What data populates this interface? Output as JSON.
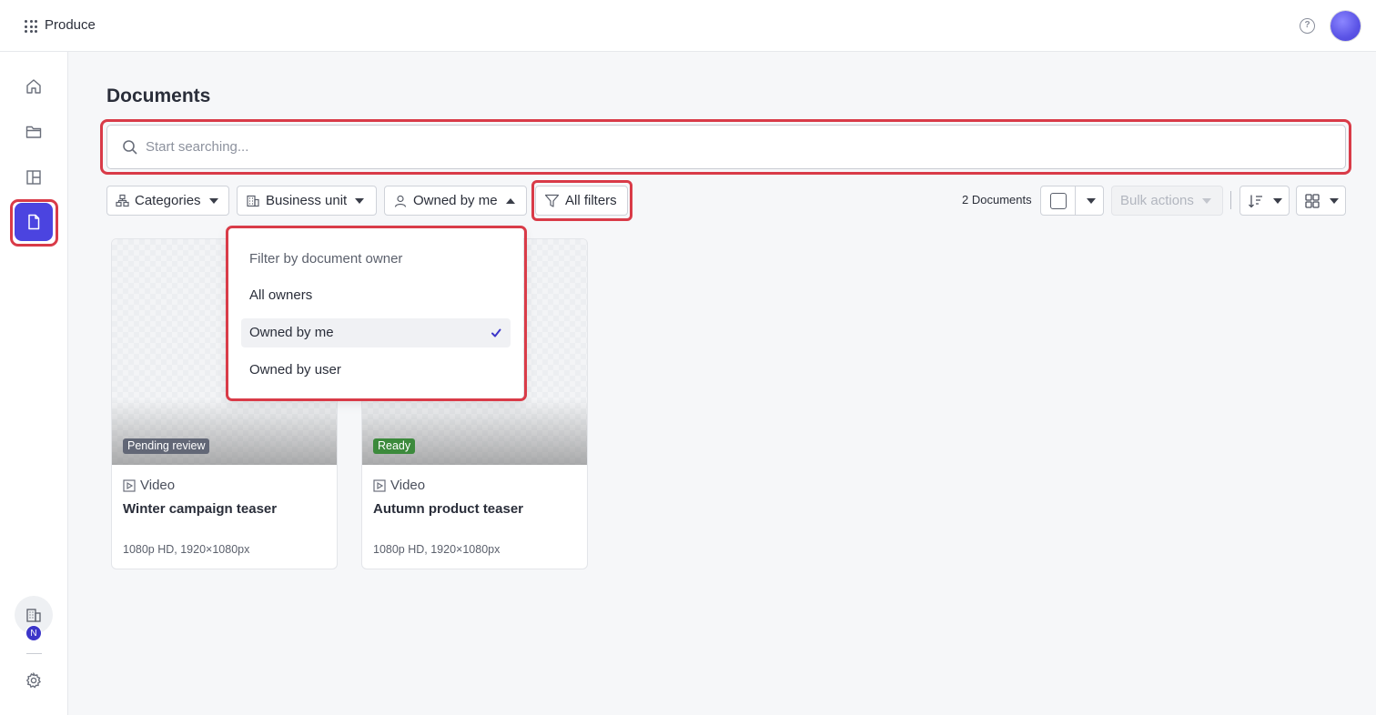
{
  "app": {
    "name": "Produce"
  },
  "header": {
    "help_icon_glyph": "?"
  },
  "sidebar": {
    "items": [
      {
        "name": "home",
        "icon": "home-icon",
        "active": false
      },
      {
        "name": "folders",
        "icon": "folder-icon",
        "active": false
      },
      {
        "name": "layouts",
        "icon": "layout-icon",
        "active": false
      },
      {
        "name": "documents",
        "icon": "document-icon",
        "active": true
      }
    ],
    "org_badge": "N"
  },
  "page": {
    "title": "Documents"
  },
  "search": {
    "placeholder": "Start searching..."
  },
  "filters": {
    "categories": "Categories",
    "business_unit": "Business unit",
    "owner": "Owned by me",
    "all_filters": "All filters"
  },
  "toolbar": {
    "count": "2 Documents",
    "bulk_actions": "Bulk actions"
  },
  "owner_dropdown": {
    "header": "Filter by document owner",
    "options": [
      {
        "label": "All owners",
        "selected": false
      },
      {
        "label": "Owned by me",
        "selected": true
      },
      {
        "label": "Owned by user",
        "selected": false
      }
    ]
  },
  "documents": [
    {
      "status": "Pending review",
      "type": "Video",
      "title": "Winter campaign teaser",
      "meta": "1080p HD, 1920×1080px"
    },
    {
      "status": "Ready",
      "type": "Video",
      "title": "Autumn product teaser",
      "meta": "1080p HD, 1920×1080px"
    }
  ],
  "colors": {
    "accent": "#4b44e0",
    "highlight": "#d93b48",
    "status_pending": "#626776",
    "status_ready": "#3c8a3c"
  }
}
